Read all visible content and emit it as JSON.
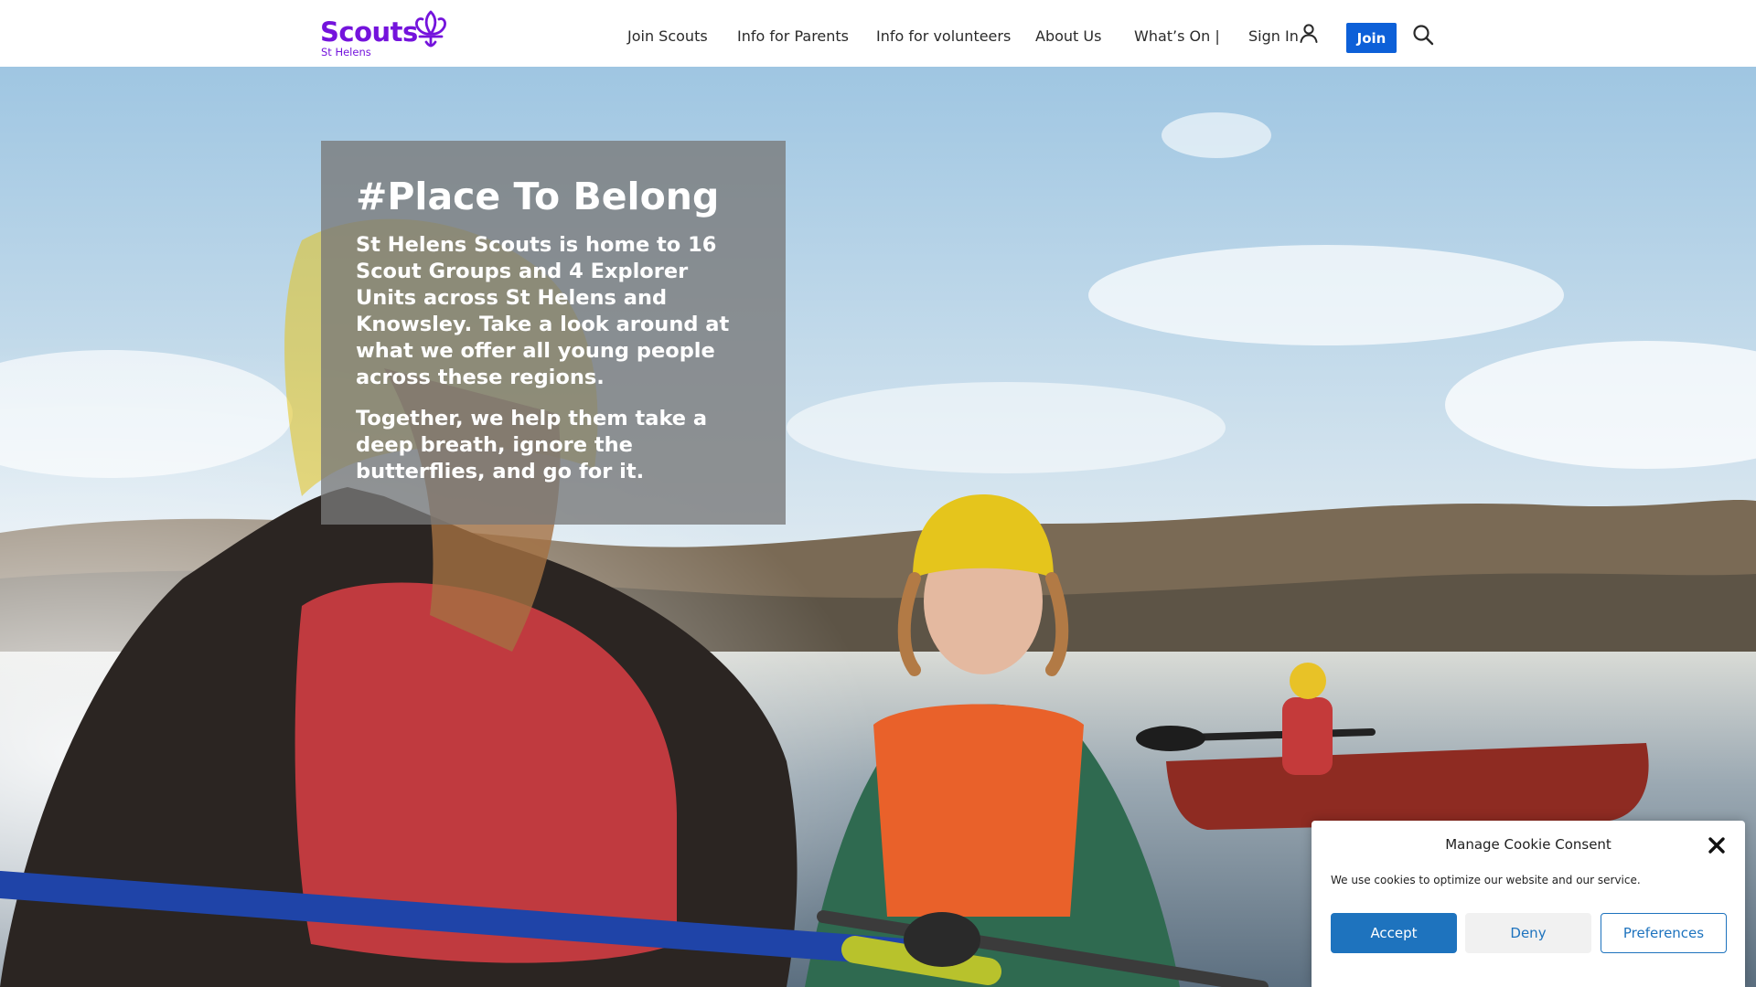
{
  "logo": {
    "name": "Scouts",
    "sub": "St Helens"
  },
  "nav": {
    "items": [
      "Join Scouts",
      "Info for Parents",
      "Info for volunteers",
      "About Us",
      "What’s On |",
      "Sign In"
    ],
    "join_label": "Join",
    "icons": {
      "user": "user-icon",
      "search": "search-icon",
      "logo": "fleur-de-lis-icon"
    }
  },
  "hero": {
    "title": "#Place To Belong",
    "paragraphs": [
      "St Helens Scouts is home to 16 Scout Groups and 4 Explorer Units across St Helens and Knowsley. Take a look around at what we offer all young people across these regions.",
      "Together, we help them take a deep breath, ignore the butterflies, and go for it."
    ]
  },
  "cookie": {
    "title": "Manage Cookie Consent",
    "text": "We use cookies to optimize our website and our service.",
    "accept": "Accept",
    "deny": "Deny",
    "preferences": "Preferences"
  },
  "colors": {
    "brand": "#7413dc",
    "join": "#0d60d8",
    "cookie_accent": "#1e73be"
  }
}
